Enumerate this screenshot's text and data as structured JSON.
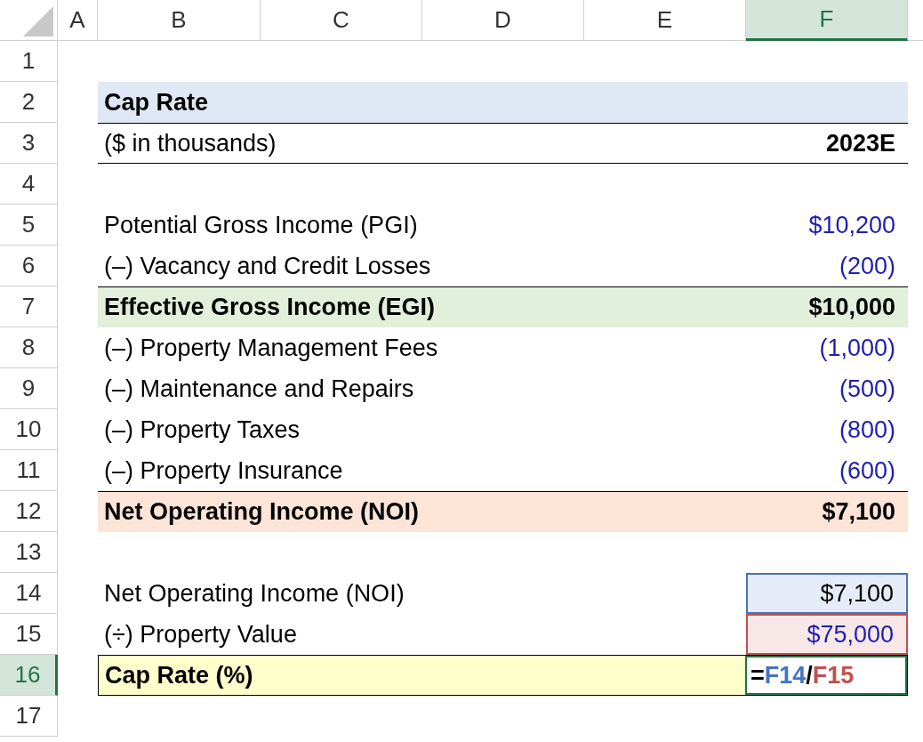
{
  "columns": [
    {
      "label": "A",
      "selected": false
    },
    {
      "label": "B",
      "selected": false
    },
    {
      "label": "C",
      "selected": false
    },
    {
      "label": "D",
      "selected": false
    },
    {
      "label": "E",
      "selected": false
    },
    {
      "label": "F",
      "selected": true
    }
  ],
  "rows": [
    {
      "number": "1",
      "selected": false,
      "kind": "blank"
    },
    {
      "number": "2",
      "selected": false,
      "kind": "title",
      "label": "Cap Rate",
      "color": "#dfe8f4"
    },
    {
      "number": "3",
      "selected": false,
      "kind": "units",
      "label": "($ in thousands)",
      "value": "2023E"
    },
    {
      "number": "4",
      "selected": false,
      "kind": "blank"
    },
    {
      "number": "5",
      "selected": false,
      "kind": "input",
      "label": "Potential Gross Income (PGI)",
      "value": "$10,200"
    },
    {
      "number": "6",
      "selected": false,
      "kind": "input",
      "label": "(–) Vacancy and Credit Losses",
      "value": "(200)"
    },
    {
      "number": "7",
      "selected": false,
      "kind": "total",
      "label": "Effective Gross Income (EGI)",
      "value": "$10,000",
      "color": "#e2efda"
    },
    {
      "number": "8",
      "selected": false,
      "kind": "input",
      "label": "(–) Property Management Fees",
      "value": "(1,000)"
    },
    {
      "number": "9",
      "selected": false,
      "kind": "input",
      "label": "(–) Maintenance and Repairs",
      "value": "(500)"
    },
    {
      "number": "10",
      "selected": false,
      "kind": "input",
      "label": "(–) Property Taxes",
      "value": "(800)"
    },
    {
      "number": "11",
      "selected": false,
      "kind": "input",
      "label": "(–) Property Insurance",
      "value": "(600)"
    },
    {
      "number": "12",
      "selected": false,
      "kind": "total",
      "label": "Net Operating Income (NOI)",
      "value": "$7,100",
      "color": "#fce4d6"
    },
    {
      "number": "13",
      "selected": false,
      "kind": "blank"
    },
    {
      "number": "14",
      "selected": false,
      "kind": "ref_calc",
      "label": "Net Operating Income (NOI)",
      "value": "$7,100",
      "color": "#4472c4"
    },
    {
      "number": "15",
      "selected": false,
      "kind": "ref_input",
      "label": "(÷) Property Value",
      "value": "$75,000",
      "color": "#c0504d"
    },
    {
      "number": "16",
      "selected": true,
      "kind": "result",
      "label": "Cap Rate (%)",
      "color": "#ffffcc",
      "formula": [
        {
          "text": "=",
          "color": "#000000"
        },
        {
          "text": "F14",
          "color": "#4472c4"
        },
        {
          "text": "/",
          "color": "#000000"
        },
        {
          "text": "F15",
          "color": "#c0504d"
        }
      ]
    },
    {
      "number": "17",
      "selected": false,
      "kind": "blank"
    }
  ]
}
